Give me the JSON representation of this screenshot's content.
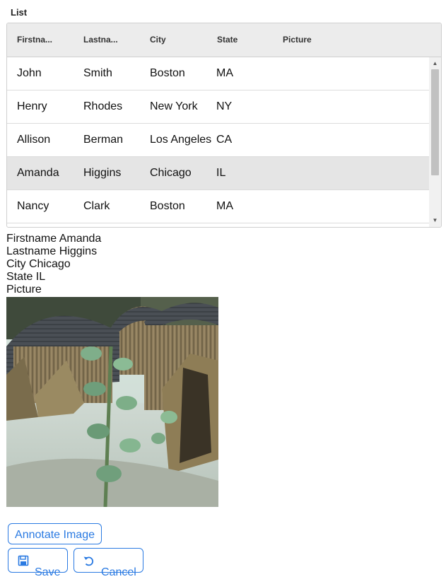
{
  "list": {
    "title": "List",
    "columns": [
      "Firstna...",
      "Lastna...",
      "City",
      "State",
      "Picture"
    ],
    "rows": [
      {
        "first": "John",
        "last": "Smith",
        "city": "Boston",
        "state": "MA"
      },
      {
        "first": "Henry",
        "last": "Rhodes",
        "city": "New York",
        "state": "NY"
      },
      {
        "first": "Allison",
        "last": "Berman",
        "city": "Los Angeles",
        "state": "CA"
      },
      {
        "first": "Amanda",
        "last": "Higgins",
        "city": "Chicago",
        "state": "IL"
      },
      {
        "first": "Nancy",
        "last": "Clark",
        "city": "Boston",
        "state": "MA"
      }
    ],
    "selected_row": "Amanda"
  },
  "details": {
    "firstname": "Firstname Amanda",
    "lastname": "Lastname Higgins",
    "city": "City Chicago",
    "state": "State IL",
    "picture": "Picture"
  },
  "buttons": {
    "annotate": "Annotate Image",
    "save": "Save",
    "cancel": "Cancel"
  },
  "colors": {
    "accent": "#2a7ae2",
    "selected_row": "#e5e5e5",
    "header_bg": "#ececec"
  }
}
